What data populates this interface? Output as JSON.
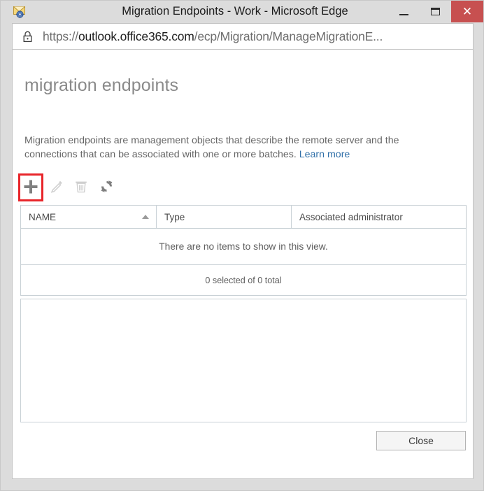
{
  "window": {
    "title": "Migration Endpoints - Work - Microsoft Edge",
    "app_icon": "mail-settings-icon",
    "minimize_label": "—",
    "maximize_label": "❐",
    "close_label": "×"
  },
  "address_bar": {
    "lock_icon": "lock-icon",
    "url_scheme": "https://",
    "url_host": "outlook.office365.com",
    "url_path": "/ecp/Migration/ManageMigrationE...",
    "full_url": "https://outlook.office365.com/ecp/Migration/ManageMigrationE..."
  },
  "page": {
    "title": "migration endpoints",
    "description_text": "Migration endpoints are management objects that describe the remote server and the connections that can be associated with one or more batches.",
    "learn_more_label": "Learn more"
  },
  "toolbar": {
    "items": [
      {
        "name": "new-endpoint",
        "icon": "plus-icon",
        "enabled": true,
        "highlighted": true
      },
      {
        "name": "edit-endpoint",
        "icon": "pencil-icon",
        "enabled": false,
        "highlighted": false
      },
      {
        "name": "delete-endpoint",
        "icon": "trash-icon",
        "enabled": false,
        "highlighted": false
      },
      {
        "name": "refresh",
        "icon": "refresh-icon",
        "enabled": true,
        "highlighted": false
      }
    ],
    "highlight_color": "#e8252a"
  },
  "grid": {
    "columns": [
      {
        "label": "NAME",
        "sorted": true,
        "sort_direction": "ascending"
      },
      {
        "label": "Type",
        "sorted": false,
        "sort_direction": ""
      },
      {
        "label": "Associated administrator",
        "sorted": false,
        "sort_direction": ""
      }
    ],
    "rows": [],
    "empty_message": "There are no items to show in this view.",
    "status_text": "0 selected of 0 total",
    "selected_count": 0,
    "total_count": 0
  },
  "details_pane": {
    "content": ""
  },
  "footer": {
    "close_label": "Close"
  }
}
